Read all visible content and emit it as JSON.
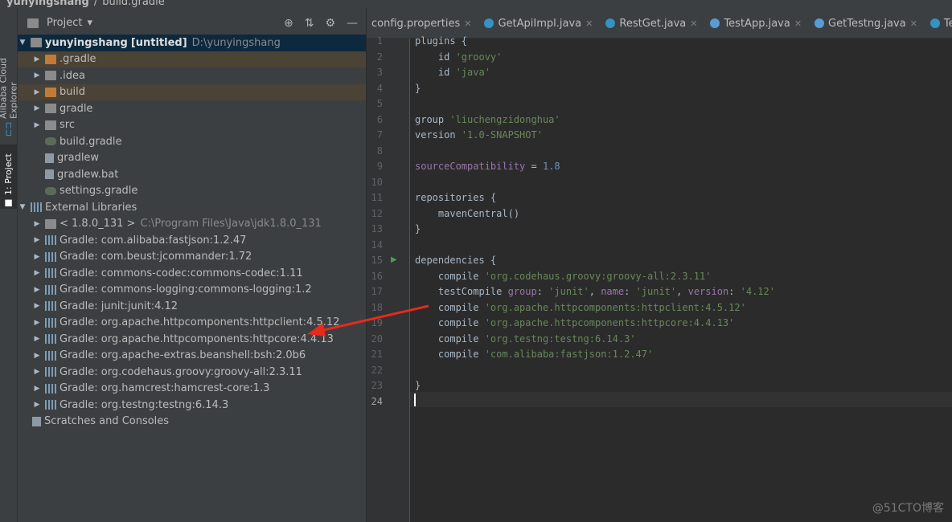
{
  "breadcrumb": {
    "project": "yunyingshang",
    "separator": "/",
    "file": "build.gradle"
  },
  "left_strip": {
    "tab1": "Alibaba Cloud Explorer",
    "tab2": "1: Project"
  },
  "panel": {
    "title": "Project",
    "dropdown": "▾",
    "tools": [
      "⊕",
      "⇅",
      "⚙",
      "—"
    ]
  },
  "tree": {
    "root_label": "yunyingshang",
    "root_tag": "[untitled]",
    "root_path": "D:\\yunyingshang",
    "items": [
      ".gradle",
      ".idea",
      "build",
      "gradle",
      "src",
      "build.gradle",
      "gradlew",
      "gradlew.bat",
      "settings.gradle"
    ],
    "external": "External Libraries",
    "jdk_label": "< 1.8.0_131 >",
    "jdk_path": "C:\\Program Files\\Java\\jdk1.8.0_131",
    "libs": [
      "Gradle: com.alibaba:fastjson:1.2.47",
      "Gradle: com.beust:jcommander:1.72",
      "Gradle: commons-codec:commons-codec:1.11",
      "Gradle: commons-logging:commons-logging:1.2",
      "Gradle: junit:junit:4.12",
      "Gradle: org.apache.httpcomponents:httpclient:4.5.12",
      "Gradle: org.apache.httpcomponents:httpcore:4.4.13",
      "Gradle: org.apache-extras.beanshell:bsh:2.0b6",
      "Gradle: org.codehaus.groovy:groovy-all:2.3.11",
      "Gradle: org.hamcrest:hamcrest-core:1.3",
      "Gradle: org.testng:testng:6.14.3"
    ],
    "scratches": "Scratches and Consoles"
  },
  "tabs": [
    "config.properties",
    "GetApiImpl.java",
    "RestGet.java",
    "TestApp.java",
    "GetTestng.java",
    "TestBas"
  ],
  "code": {
    "line_numbers": [
      "1",
      "2",
      "3",
      "4",
      "5",
      "6",
      "7",
      "8",
      "9",
      "10",
      "11",
      "12",
      "13",
      "14",
      "15",
      "16",
      "17",
      "18",
      "19",
      "20",
      "21",
      "22",
      "23",
      "24"
    ],
    "l1": "plugins {",
    "l2a": "    id ",
    "l2b": "'groovy'",
    "l3a": "    id ",
    "l3b": "'java'",
    "l4": "}",
    "l6a": "group ",
    "l6b": "'liuchengzidonghua'",
    "l7a": "version ",
    "l7b": "'1.0-SNAPSHOT'",
    "l9a": "sourceCompatibility",
    "l9b": " = ",
    "l9c": "1.8",
    "l11": "repositories {",
    "l12": "    mavenCentral()",
    "l13": "}",
    "l15": "dependencies {",
    "l16a": "    compile ",
    "l16b": "'org.codehaus.groovy:groovy-all:2.3.11'",
    "l17a": "    testCompile ",
    "l17b": "group",
    "l17c": ": ",
    "l17d": "'junit'",
    "l17e": ", ",
    "l17f": "name",
    "l17g": ": ",
    "l17h": "'junit'",
    "l17i": ", ",
    "l17j": "version",
    "l17k": ": ",
    "l17l": "'4.12'",
    "l18a": "    compile ",
    "l18b": "'org.apache.httpcomponents:httpclient:4.5.12'",
    "l19a": "    compile ",
    "l19b": "'org.apache.httpcomponents:httpcore:4.4.13'",
    "l20a": "    compile ",
    "l20b": "'org.testng:testng:6.14.3'",
    "l21a": "    compile ",
    "l21b": "'com.alibaba:fastjson:1.2.47'",
    "l23": "}"
  },
  "watermark": "@51CTO博客",
  "colors": {
    "accent": "#4a88c7",
    "arrow": "#e8291c",
    "selection": "#0d293e"
  }
}
